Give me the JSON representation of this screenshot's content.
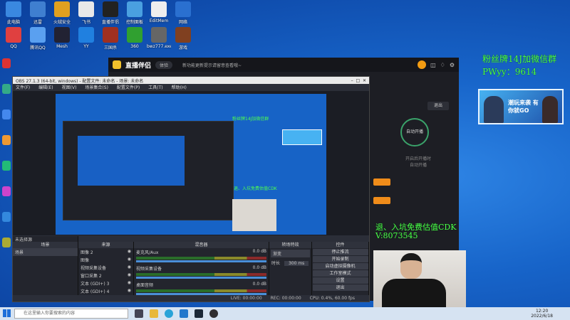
{
  "desktop_icons": [
    {
      "label": "此电脑",
      "color": "#3a88e0"
    },
    {
      "label": "迅雷",
      "color": "#3f7fd0"
    },
    {
      "label": "火绒安全",
      "color": "#e0a020"
    },
    {
      "label": "飞书",
      "color": "#e8e8e8"
    },
    {
      "label": "直播伴侣",
      "color": "#222"
    },
    {
      "label": "控制面板",
      "color": "#4aa0e0"
    },
    {
      "label": "EditMem",
      "color": "#eee"
    },
    {
      "label": "网络",
      "color": "#2a70d0"
    },
    {
      "label": "QQ",
      "color": "#e04040"
    },
    {
      "label": "腾讯QQ",
      "color": "#5aa0f0"
    },
    {
      "label": "Mesh",
      "color": "#223"
    },
    {
      "label": "YY",
      "color": "#2080e0"
    },
    {
      "label": "三国杀",
      "color": "#a03020"
    },
    {
      "label": "360",
      "color": "#30a030"
    },
    {
      "label": "bwz777.exe",
      "color": "#666"
    },
    {
      "label": "游戏",
      "color": "#804020"
    }
  ],
  "assistant": {
    "app_name": "直播伴侣",
    "badge": "体验",
    "notice": "新功能更新提示请留意查看哦~"
  },
  "overlay": {
    "fan_text": "粉丝牌14J加微信群",
    "pwyy": "PWyy：9614",
    "cdk_line1": "退、入坑免费估值CDK",
    "cdk_line2": "V:8073545",
    "banner_text": "潮玩来袭 有你就GO"
  },
  "assistant_panel": {
    "btn_exit": "退出",
    "auto_label": "自动开播",
    "side_text1": "开启后开播时",
    "side_text2": "自动开播"
  },
  "obs": {
    "title": "OBS 27.1.3 (64-bit, windows) - 配置文件: 未命名 - 场景: 未命名",
    "menu": [
      "文件(F)",
      "编辑(E)",
      "视图(V)",
      "场景集合(S)",
      "配置文件(P)",
      "工具(T)",
      "帮助(H)"
    ],
    "no_source": "未选择源",
    "docks": {
      "scenes": {
        "header": "场景",
        "items": [
          "场景"
        ]
      },
      "sources": {
        "header": "来源",
        "items": [
          "图像 2",
          "图像",
          "视频采集设备",
          "窗口采集 2",
          "文本 (GDI+) 3",
          "文本 (GDI+) 4"
        ]
      },
      "mixer": {
        "header": "混音器",
        "channels": [
          {
            "name": "麦克风/Aux",
            "db": "0.0 dB"
          },
          {
            "name": "视频采集设备",
            "db": "0.0 dB"
          },
          {
            "name": "桌面音频",
            "db": "0.0 dB"
          }
        ]
      },
      "transitions": {
        "header": "转场特效",
        "type": "渐变",
        "duration_label": "时长",
        "duration": "300 ms"
      },
      "controls": {
        "header": "控件",
        "buttons": [
          "停止推流",
          "开始录制",
          "启动虚拟摄像机",
          "工作室模式",
          "设置",
          "退出"
        ]
      }
    },
    "status": {
      "live": "LIVE: 00:00:00",
      "rec": "REC: 00:00:00",
      "cpu": "CPU: 0.4%, 60.00 fps"
    }
  },
  "taskbar": {
    "search_placeholder": "在这里输入你要搜索的内容",
    "time": "12:20",
    "date": "2022/6/18"
  }
}
